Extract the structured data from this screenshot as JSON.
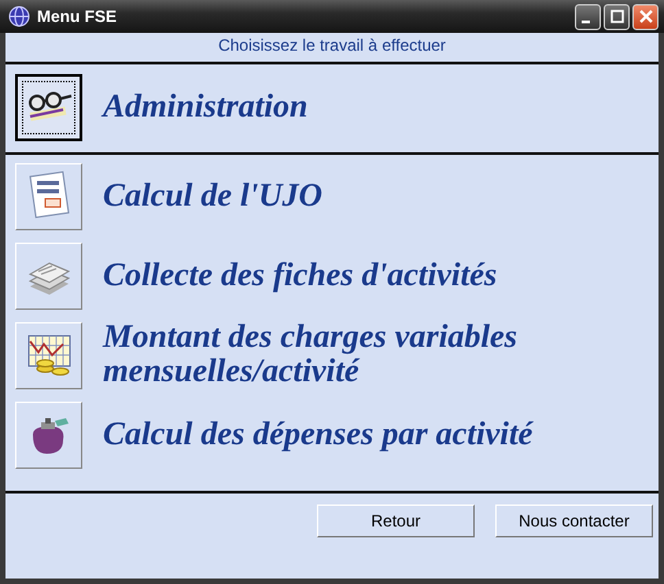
{
  "window": {
    "title": "Menu FSE"
  },
  "heading": "Choisissez le travail à effectuer",
  "sections": [
    {
      "items": [
        {
          "label": "Administration",
          "selected": true
        }
      ]
    },
    {
      "items": [
        {
          "label": "Calcul de l'UJO",
          "selected": false
        },
        {
          "label": "Collecte des fiches d'activités",
          "selected": false
        },
        {
          "label": "Montant des charges variables mensuelles/activité",
          "selected": false
        },
        {
          "label": "Calcul des dépenses par activité",
          "selected": false
        }
      ]
    }
  ],
  "buttons": [
    "Retour",
    "Nous contacter"
  ]
}
